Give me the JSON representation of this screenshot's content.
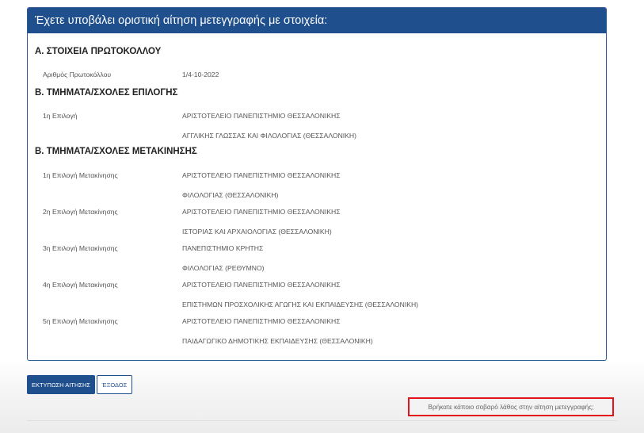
{
  "panel": {
    "title": "Έχετε υποβάλει οριστική αίτηση μετεγγραφής με στοιχεία:"
  },
  "section_a": {
    "title": "Α. ΣΤΟΙΧΕΙΑ ΠΡΩΤΟΚΟΛΛΟΥ",
    "protocol_label": "Αριθμός Πρωτοκόλλου",
    "protocol_value": "1/4-10-2022"
  },
  "section_b": {
    "title": "Β. ΤΜΗΜΑΤΑ/ΣΧΟΛΕΣ ΕΠΙΛΟΓΗΣ",
    "rows": [
      {
        "label": "1η Επιλογή",
        "university": "ΑΡΙΣΤΟΤΕΛΕΙΟ ΠΑΝΕΠΙΣΤΗΜΙΟ ΘΕΣΣΑΛΟΝΙΚΗΣ",
        "department": "ΑΓΓΛΙΚΗΣ ΓΛΩΣΣΑΣ ΚΑΙ ΦΙΛΟΛΟΓΙΑΣ (ΘΕΣΣΑΛΟΝΙΚΗ)"
      }
    ]
  },
  "section_c": {
    "title": "Β. ΤΜΗΜΑΤΑ/ΣΧΟΛΕΣ ΜΕΤΑΚΙΝΗΣΗΣ",
    "rows": [
      {
        "label": "1η Επιλογή Μετακίνησης",
        "university": "ΑΡΙΣΤΟΤΕΛΕΙΟ ΠΑΝΕΠΙΣΤΗΜΙΟ ΘΕΣΣΑΛΟΝΙΚΗΣ",
        "department": "ΦΙΛΟΛΟΓΙΑΣ (ΘΕΣΣΑΛΟΝΙΚΗ)"
      },
      {
        "label": "2η Επιλογή Μετακίνησης",
        "university": "ΑΡΙΣΤΟΤΕΛΕΙΟ ΠΑΝΕΠΙΣΤΗΜΙΟ ΘΕΣΣΑΛΟΝΙΚΗΣ",
        "department": "ΙΣΤΟΡΙΑΣ ΚΑΙ ΑΡΧΑΙΟΛΟΓΙΑΣ (ΘΕΣΣΑΛΟΝΙΚΗ)"
      },
      {
        "label": "3η Επιλογή Μετακίνησης",
        "university": "ΠΑΝΕΠΙΣΤΗΜΙΟ ΚΡΗΤΗΣ",
        "department": "ΦΙΛΟΛΟΓΙΑΣ (ΡΕΘΥΜΝΟ)"
      },
      {
        "label": "4η Επιλογή Μετακίνησης",
        "university": "ΑΡΙΣΤΟΤΕΛΕΙΟ ΠΑΝΕΠΙΣΤΗΜΙΟ ΘΕΣΣΑΛΟΝΙΚΗΣ",
        "department": "ΕΠΙΣΤΗΜΩΝ ΠΡΟΣΧΟΛΙΚΗΣ ΑΓΩΓΗΣ ΚΑΙ ΕΚΠΑΙΔΕΥΣΗΣ (ΘΕΣΣΑΛΟΝΙΚΗ)"
      },
      {
        "label": "5η Επιλογή Μετακίνησης",
        "university": "ΑΡΙΣΤΟΤΕΛΕΙΟ ΠΑΝΕΠΙΣΤΗΜΙΟ ΘΕΣΣΑΛΟΝΙΚΗΣ",
        "department": "ΠΑΙΔΑΓΩΓΙΚΟ ΔΗΜΟΤΙΚΗΣ ΕΚΠΑΙΔΕΥΣΗΣ (ΘΕΣΣΑΛΟΝΙΚΗ)"
      }
    ]
  },
  "actions": {
    "print_label": "ΕΚΤΥΠΩΣΗ ΑΙΤΗΣΗΣ",
    "exit_label": "ΈΞΟΔΟΣ",
    "error_link": "Βρήκατε κάποιο σοβαρό λάθος στην αίτηση μετεγγραφής;"
  },
  "colors": {
    "header_bg": "#1f4f8c",
    "highlight_border": "#e3131b"
  }
}
